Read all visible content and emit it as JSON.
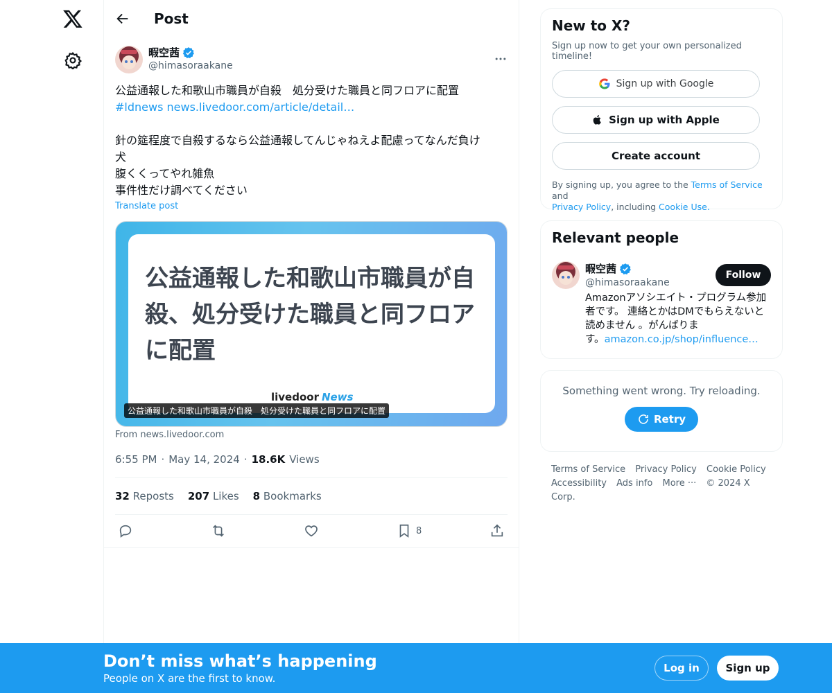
{
  "header": {
    "title": "Post"
  },
  "post": {
    "author_name": "暇空茜",
    "author_handle": "@himasoraakane",
    "text_lines": [
      "公益通報した和歌山市職員が自殺　処分受けた職員と同フロアに配置",
      "",
      "針の筵程度で自殺するなら公益通報してんじゃねえよ配慮ってなんだ負け",
      "犬",
      "腹くくってやれ雑魚",
      "事件性だけ調べてください"
    ],
    "hashtag": "#ldnews",
    "link": "news.livedoor.com/article/detail…",
    "translate_label": "Translate post",
    "card": {
      "headline_lines": [
        "公益通報した和歌山市職員が自",
        "殺、処分受けた職員と同フロア",
        "に配置"
      ],
      "brand": "livedoor",
      "brand_news": "News",
      "caption": "公益通報した和歌山市職員が自殺　処分受けた職員と同フロアに配置",
      "from": "From news.livedoor.com"
    },
    "time": "6:55 PM",
    "date": "May 14, 2024",
    "views": "18.6K",
    "views_label": "Views",
    "reposts": "32",
    "reposts_label": "Reposts",
    "likes": "207",
    "likes_label": "Likes",
    "bookmarks": "8",
    "bookmarks_label": "Bookmarks",
    "bookmark_count": "8"
  },
  "sidebar": {
    "new_to_x": {
      "title": "New to X?",
      "subtitle": "Sign up now to get your own personalized timeline!",
      "google": "Sign up with Google",
      "apple": "Sign up with Apple",
      "create": "Create account",
      "legal_prefix": "By signing up, you agree to the ",
      "terms": "Terms of Service",
      "and": " and",
      "privacy": "Privacy Policy",
      "including": ", including ",
      "cookie": "Cookie Use",
      "period": "."
    },
    "relevant": {
      "title": "Relevant people",
      "name": "暇空茜",
      "handle": "@himasoraakane",
      "follow": "Follow",
      "bio_lines": [
        "Amazonアソシエイト・プログラム参加",
        "者です。 連絡とかはDMでもらえないと",
        "読めません 。がんばりま"
      ],
      "bio_last": "す。",
      "bio_link": "amazon.co.jp/shop/influence…"
    },
    "error": {
      "message": "Something went wrong. Try reloading.",
      "retry": "Retry"
    },
    "footer": {
      "links_row1": [
        "Terms of Service",
        "Privacy Policy",
        "Cookie Policy"
      ],
      "links_row2": [
        "Accessibility",
        "Ads info",
        "More ···"
      ],
      "copyright": "© 2024 X Corp."
    }
  },
  "bottom_bar": {
    "title": "Don’t miss what’s happening",
    "subtitle": "People on X are the first to know.",
    "login": "Log in",
    "signup": "Sign up"
  },
  "colors": {
    "accent": "#1d9bf0",
    "text": "#0f1419",
    "muted": "#536471"
  },
  "icons": [
    "x-logo-icon",
    "settings-icon",
    "back-arrow-icon",
    "verified-icon",
    "more-icon",
    "reply-icon",
    "repost-icon",
    "like-icon",
    "bookmark-icon",
    "share-icon",
    "google-icon",
    "apple-icon",
    "retry-icon"
  ]
}
